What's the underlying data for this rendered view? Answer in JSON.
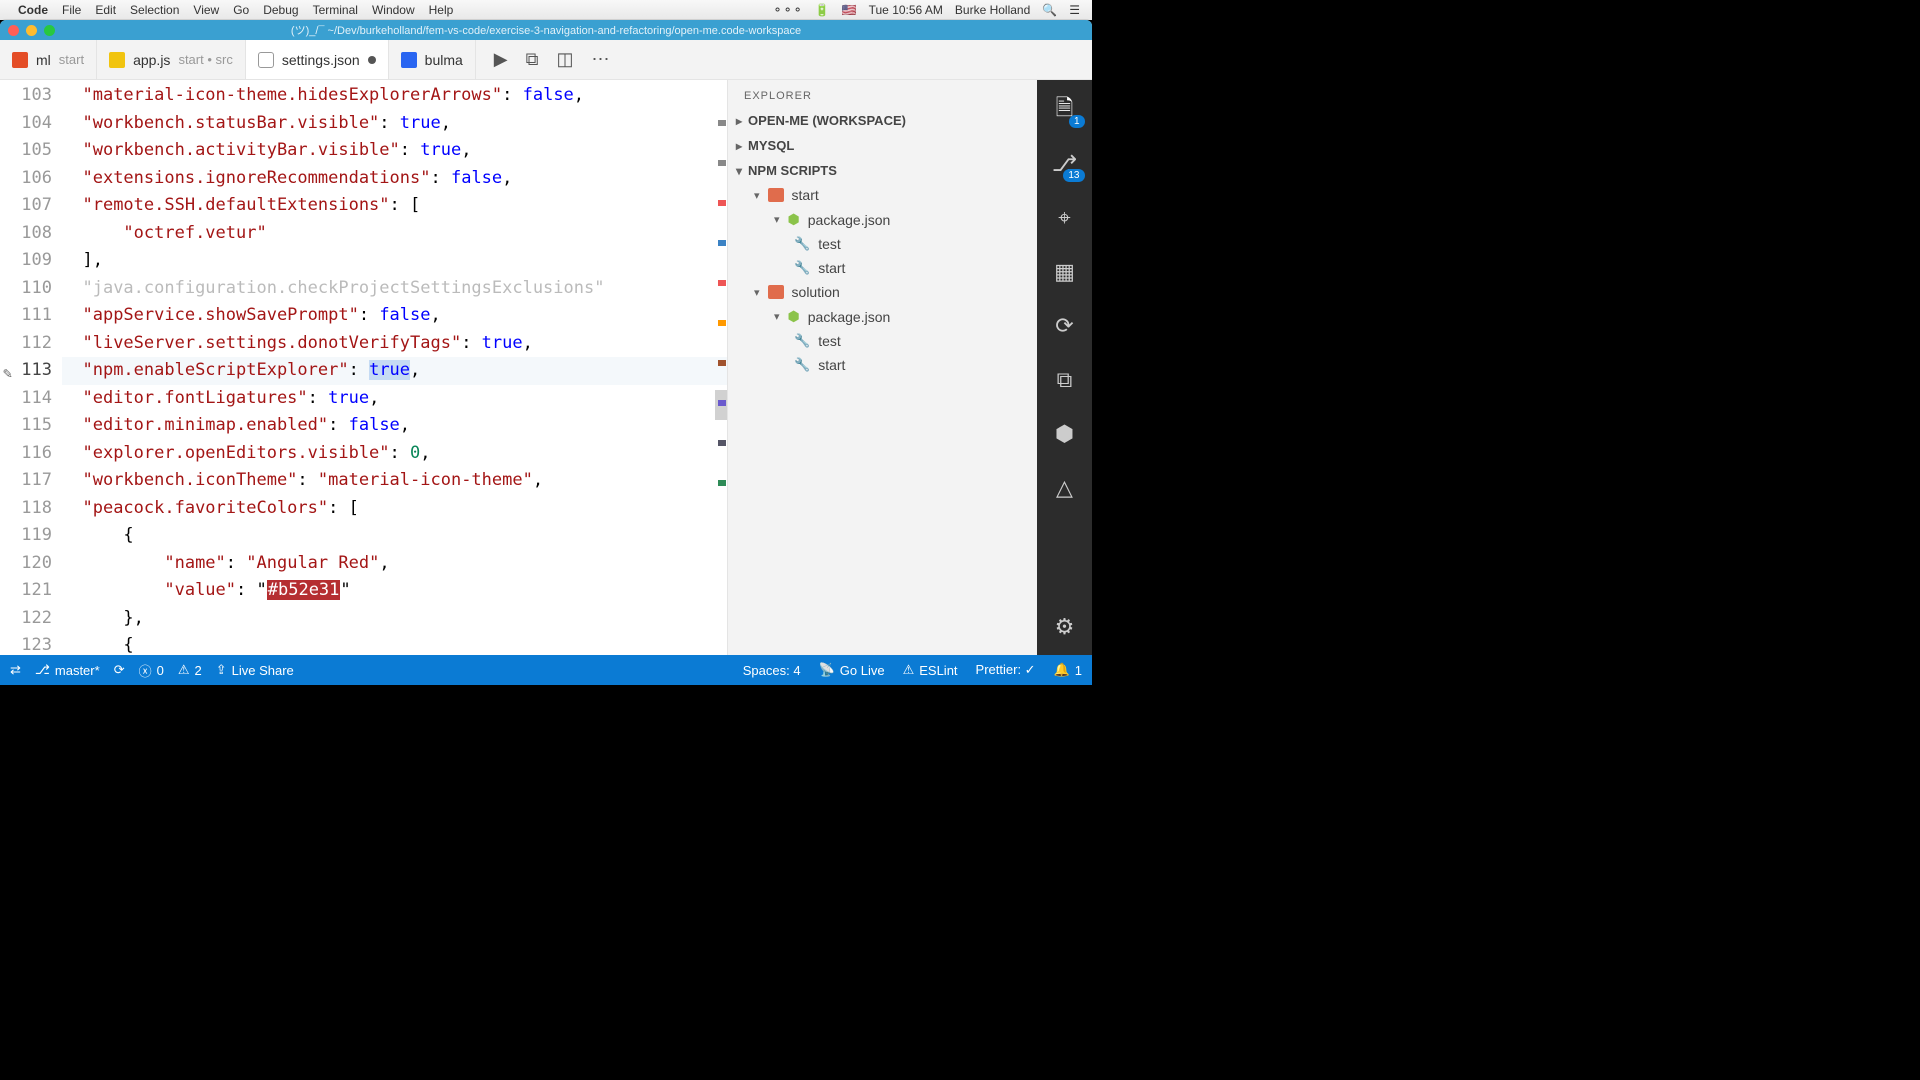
{
  "menubar": {
    "app": "Code",
    "items": [
      "File",
      "Edit",
      "Selection",
      "View",
      "Go",
      "Debug",
      "Terminal",
      "Window",
      "Help"
    ],
    "right": {
      "time": "Tue 10:56 AM",
      "user": "Burke Holland"
    }
  },
  "titlebar": {
    "path": "(ツ)_/¯ ~/Dev/burkeholland/fem-vs-code/exercise-3-navigation-and-refactoring/open-me.code-workspace"
  },
  "tabs": [
    {
      "fname": "ml",
      "desc": "start",
      "icon": "html"
    },
    {
      "fname": "app.js",
      "desc": "start • src",
      "icon": "js"
    },
    {
      "fname": "settings.json",
      "desc": "",
      "icon": "json",
      "active": true,
      "dirty": true
    },
    {
      "fname": "bulma",
      "desc": "",
      "icon": "css"
    }
  ],
  "editor": {
    "lines_start": 103,
    "current_line": 113,
    "lines": [
      {
        "n": 103,
        "t": [
          [
            "key",
            "\"material-icon-theme.hidesExplorerArrows\""
          ],
          [
            "pun",
            ": "
          ],
          [
            "bool",
            "false"
          ],
          [
            "pun",
            ","
          ]
        ]
      },
      {
        "n": 104,
        "t": [
          [
            "key",
            "\"workbench.statusBar.visible\""
          ],
          [
            "pun",
            ": "
          ],
          [
            "bool",
            "true"
          ],
          [
            "pun",
            ","
          ]
        ]
      },
      {
        "n": 105,
        "t": [
          [
            "key",
            "\"workbench.activityBar.visible\""
          ],
          [
            "pun",
            ": "
          ],
          [
            "bool",
            "true"
          ],
          [
            "pun",
            ","
          ]
        ]
      },
      {
        "n": 106,
        "t": [
          [
            "key",
            "\"extensions.ignoreRecommendations\""
          ],
          [
            "pun",
            ": "
          ],
          [
            "bool",
            "false"
          ],
          [
            "pun",
            ","
          ]
        ]
      },
      {
        "n": 107,
        "t": [
          [
            "key",
            "\"remote.SSH.defaultExtensions\""
          ],
          [
            "pun",
            ": ["
          ]
        ]
      },
      {
        "n": 108,
        "indent": 2,
        "t": [
          [
            "str",
            "\"octref.vetur\""
          ]
        ]
      },
      {
        "n": 109,
        "t": [
          [
            "pun",
            "],"
          ]
        ]
      },
      {
        "n": 110,
        "t": [
          [
            "dim",
            "\"java.configuration.checkProjectSettingsExclusions\""
          ]
        ]
      },
      {
        "n": 111,
        "t": [
          [
            "key",
            "\"appService.showSavePrompt\""
          ],
          [
            "pun",
            ": "
          ],
          [
            "bool",
            "false"
          ],
          [
            "pun",
            ","
          ]
        ]
      },
      {
        "n": 112,
        "t": [
          [
            "key",
            "\"liveServer.settings.donotVerifyTags\""
          ],
          [
            "pun",
            ": "
          ],
          [
            "bool",
            "true"
          ],
          [
            "pun",
            ","
          ]
        ]
      },
      {
        "n": 113,
        "hl": true,
        "t": [
          [
            "key",
            "\"npm.enableScriptExplorer\""
          ],
          [
            "pun",
            ": "
          ],
          [
            "bool sel",
            "true"
          ],
          [
            "pun",
            ","
          ]
        ]
      },
      {
        "n": 114,
        "t": [
          [
            "key",
            "\"editor.fontLigatures\""
          ],
          [
            "pun",
            ": "
          ],
          [
            "bool",
            "true"
          ],
          [
            "pun",
            ","
          ]
        ]
      },
      {
        "n": 115,
        "t": [
          [
            "key",
            "\"editor.minimap.enabled\""
          ],
          [
            "pun",
            ": "
          ],
          [
            "bool",
            "false"
          ],
          [
            "pun",
            ","
          ]
        ]
      },
      {
        "n": 116,
        "t": [
          [
            "key",
            "\"explorer.openEditors.visible\""
          ],
          [
            "pun",
            ": "
          ],
          [
            "num",
            "0"
          ],
          [
            "pun",
            ","
          ]
        ]
      },
      {
        "n": 117,
        "t": [
          [
            "key",
            "\"workbench.iconTheme\""
          ],
          [
            "pun",
            ": "
          ],
          [
            "str",
            "\"material-icon-theme\""
          ],
          [
            "pun",
            ","
          ]
        ]
      },
      {
        "n": 118,
        "t": [
          [
            "key",
            "\"peacock.favoriteColors\""
          ],
          [
            "pun",
            ": ["
          ]
        ]
      },
      {
        "n": 119,
        "indent": 2,
        "t": [
          [
            "pun",
            "{"
          ]
        ]
      },
      {
        "n": 120,
        "indent": 4,
        "t": [
          [
            "key",
            "\"name\""
          ],
          [
            "pun",
            ": "
          ],
          [
            "str",
            "\"Angular Red\""
          ],
          [
            "pun",
            ","
          ]
        ]
      },
      {
        "n": 121,
        "indent": 4,
        "t": [
          [
            "key",
            "\"value\""
          ],
          [
            "pun",
            ": "
          ],
          [
            "pun",
            "\""
          ],
          [
            "hexbg",
            "#b52e31"
          ],
          [
            "pun",
            "\""
          ]
        ]
      },
      {
        "n": 122,
        "indent": 2,
        "t": [
          [
            "pun",
            "},"
          ]
        ]
      },
      {
        "n": 123,
        "indent": 2,
        "t": [
          [
            "pun",
            "{"
          ]
        ]
      }
    ]
  },
  "explorer": {
    "title": "EXPLORER",
    "sections": [
      {
        "name": "OPEN-ME (WORKSPACE)",
        "open": false
      },
      {
        "name": "MYSQL",
        "open": false
      },
      {
        "name": "NPM SCRIPTS",
        "open": true
      }
    ],
    "npm_scripts": [
      {
        "name": "start",
        "type": "folder",
        "open": true,
        "depth": 0
      },
      {
        "name": "package.json",
        "type": "pkg",
        "depth": 1
      },
      {
        "name": "test",
        "type": "script",
        "depth": 2
      },
      {
        "name": "start",
        "type": "script",
        "depth": 2
      },
      {
        "name": "solution",
        "type": "folder",
        "open": true,
        "depth": 0
      },
      {
        "name": "package.json",
        "type": "pkg",
        "depth": 1
      },
      {
        "name": "test",
        "type": "script",
        "depth": 2
      },
      {
        "name": "start",
        "type": "script",
        "depth": 2
      }
    ]
  },
  "activity": {
    "items": [
      {
        "name": "files-icon",
        "glyph": "🗎",
        "badge": "1",
        "active": true
      },
      {
        "name": "scm-icon",
        "glyph": "⎇",
        "badge": "13"
      },
      {
        "name": "debug-icon",
        "glyph": "⌖"
      },
      {
        "name": "extensions-icon",
        "glyph": "▦"
      },
      {
        "name": "remote-icon",
        "glyph": "⟳"
      },
      {
        "name": "live-icon",
        "glyph": "⧉"
      },
      {
        "name": "docker-icon",
        "glyph": "⬢"
      },
      {
        "name": "azure-icon",
        "glyph": "△"
      }
    ]
  },
  "status": {
    "remote_icon": "⇄",
    "branch": "master*",
    "sync": "⟳",
    "errors": "0",
    "warnings": "2",
    "liveshare": "Live Share",
    "spaces": "Spaces: 4",
    "golive": "Go Live",
    "eslint": "ESLint",
    "prettier": "Prettier: ✓",
    "bell": "1"
  },
  "minimap_colors": [
    "#888",
    "#888",
    "#e55",
    "#3b82c4",
    "#e55",
    "#f90",
    "#a0522d",
    "#6a5acd",
    "#556",
    "#2e8b57"
  ]
}
